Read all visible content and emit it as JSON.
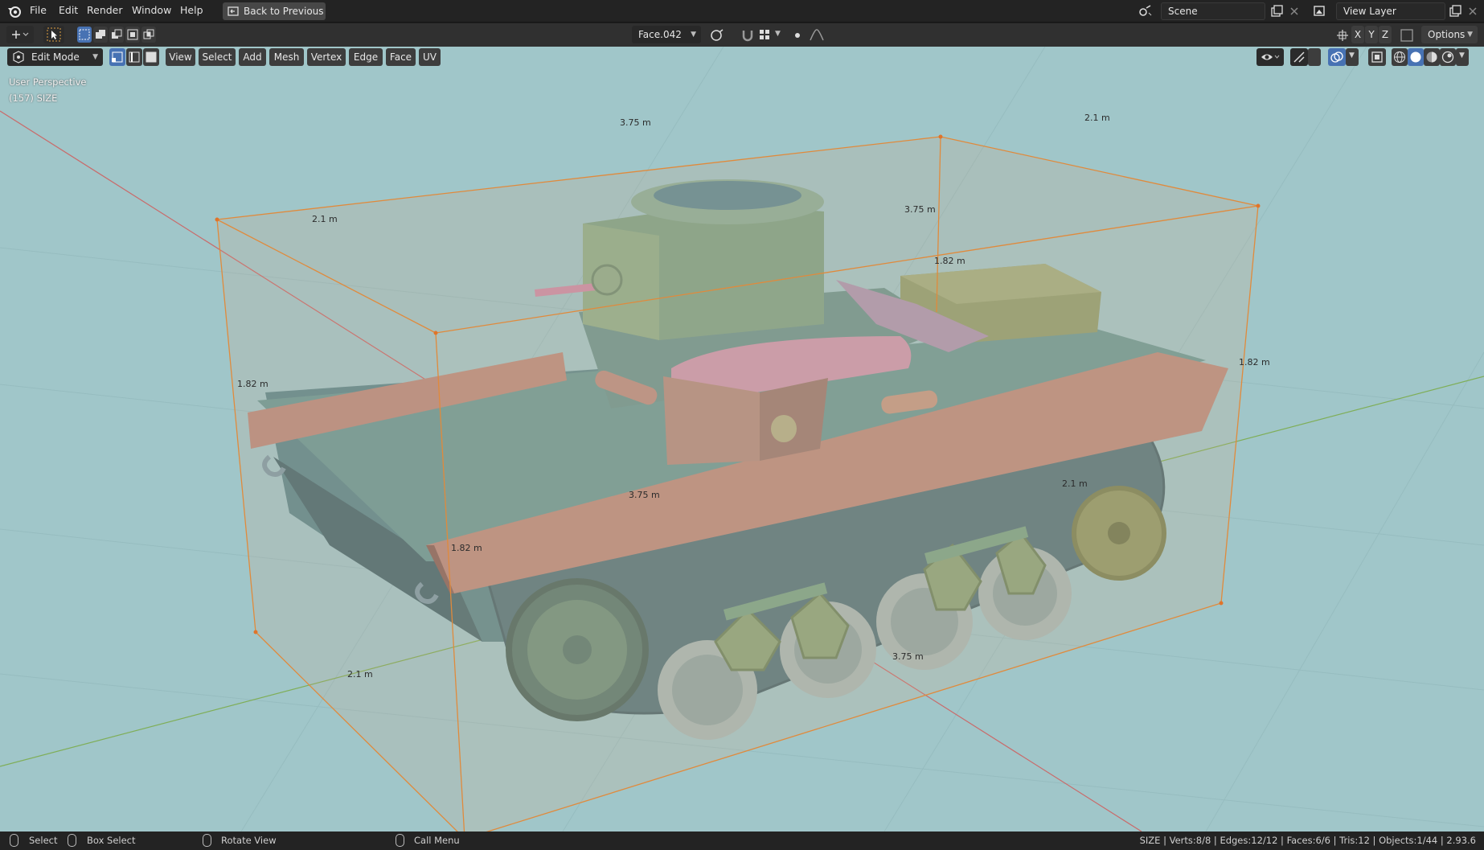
{
  "menu": {
    "items": [
      "File",
      "Edit",
      "Render",
      "Window",
      "Help"
    ],
    "back_button": "Back to Previous"
  },
  "scene": {
    "label": "Scene"
  },
  "view_layer": {
    "label": "View Layer"
  },
  "header": {
    "object_dropdown": "Face.042",
    "axis_x": "X",
    "axis_y": "Y",
    "axis_z": "Z",
    "options": "Options",
    "mode": "Edit Mode",
    "menus": [
      "View",
      "Select",
      "Add",
      "Mesh",
      "Vertex",
      "Edge",
      "Face",
      "UV"
    ]
  },
  "viewport": {
    "perspective": "User Perspective",
    "object_info": "(157) SIZE",
    "dimensions": {
      "top_length": "3.75 m",
      "top_right_width": "2.1 m",
      "left_width": "2.1 m",
      "mid_length": "3.75 m",
      "mid_height": "1.82 m",
      "right_height": "1.82 m",
      "left_height": "1.82 m",
      "front_length": "3.75 m",
      "front_height": "1.82 m",
      "right_width": "2.1 m",
      "bottom_width": "2.1 m",
      "bottom_length": "3.75 m"
    },
    "colors": {
      "background": "#a0c6c9",
      "bbox_edge": "#e08a3c",
      "x_axis": "#c96b6b",
      "y_axis": "#7fae58"
    }
  },
  "status": {
    "select": "Select",
    "box_select": "Box Select",
    "rotate_view": "Rotate View",
    "call_menu": "Call Menu",
    "stats": "SIZE | Verts:8/8 | Edges:12/12 | Faces:6/6 | Tris:12 | Objects:1/44 | 2.93.6"
  }
}
